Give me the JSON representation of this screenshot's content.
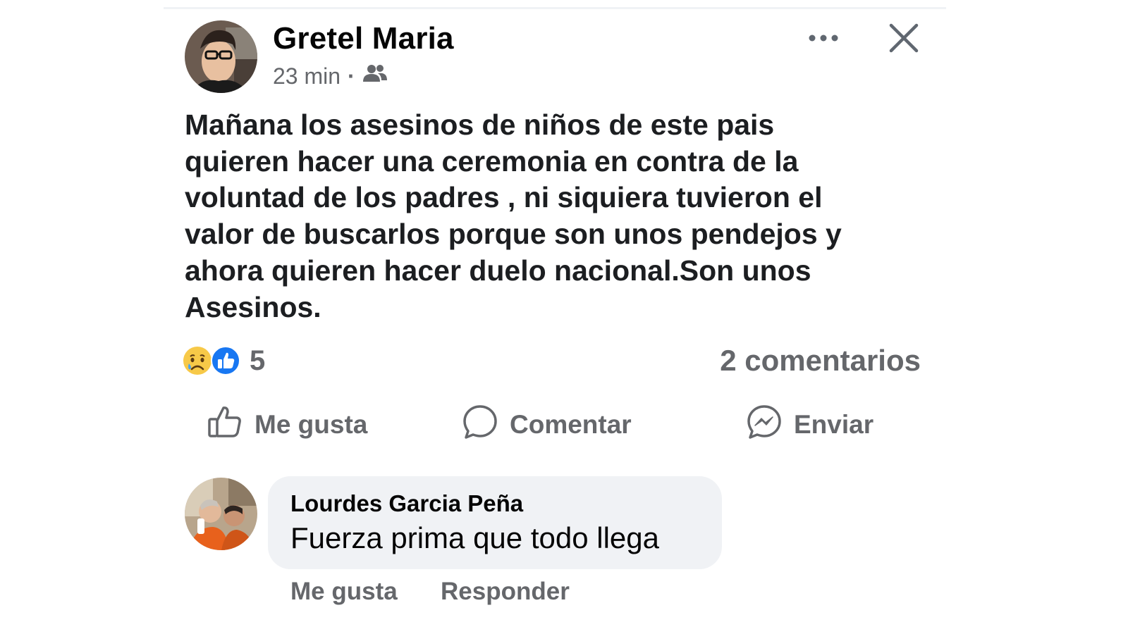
{
  "post": {
    "author_name": "Gretel Maria",
    "time_ago": "23 min",
    "separator": "·",
    "audience_icon": "friends-icon",
    "text": "Mañana los asesinos de niños de este pais\nquieren hacer una ceremonia en contra de la\nvoluntad de los padres , ni siquiera tuvieron el\nvalor de buscarlos porque son unos pendejos y\nahora quieren hacer duelo nacional.Son unos\nAsesinos.",
    "reactions": {
      "icons": [
        "sad-reaction-icon",
        "like-reaction-icon"
      ],
      "count": "5"
    },
    "comments_count": "2 comentarios"
  },
  "actions": {
    "like_label": "Me gusta",
    "comment_label": "Comentar",
    "send_label": "Enviar"
  },
  "comment": {
    "author_name": "Lourdes Garcia Peña",
    "text": "Fuerza prima que todo llega",
    "like_label": "Me gusta",
    "reply_label": "Responder"
  },
  "colors": {
    "text": "#050505",
    "secondary_text": "#65676b",
    "bubble": "#f0f2f5",
    "like_blue": "#1877f2",
    "sad_yellow": "#f7c948"
  }
}
